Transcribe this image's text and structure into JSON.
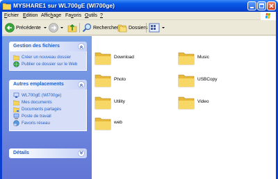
{
  "window": {
    "title": "MYSHARE1 sur WL700gE (Wl700ge)"
  },
  "menu": [
    {
      "pre": "",
      "key": "F",
      "post": "ichier"
    },
    {
      "pre": "",
      "key": "E",
      "post": "dition"
    },
    {
      "pre": "Affic",
      "key": "h",
      "post": "age"
    },
    {
      "pre": "Fa",
      "key": "v",
      "post": "oris"
    },
    {
      "pre": "",
      "key": "O",
      "post": "utils"
    },
    {
      "pre": "",
      "key": "?",
      "post": ""
    }
  ],
  "toolbar": {
    "back_label": "Précédente",
    "search_label": "Rechercher",
    "folders_label": "Dossiers"
  },
  "taskpane": {
    "file_tasks": {
      "title": "Gestion des fichiers",
      "items": [
        "Créer un nouveau dossier",
        "Publier ce dossier sur le Web"
      ]
    },
    "other_places": {
      "title": "Autres emplacements",
      "items": [
        "WL700gE (Wl700ge)",
        "Mes documents",
        "Documents partagés",
        "Poste de travail",
        "Favoris réseau"
      ]
    },
    "details": {
      "title": "Détails"
    }
  },
  "folders": [
    "Download",
    "Music",
    "Photo",
    "USBCopy",
    "Utility",
    "Video",
    "web"
  ],
  "colors": {
    "titlebar": "#0a5ce8",
    "taskpane": "#6e8ce0",
    "link": "#215dc6",
    "folder": "#f5d35a"
  }
}
